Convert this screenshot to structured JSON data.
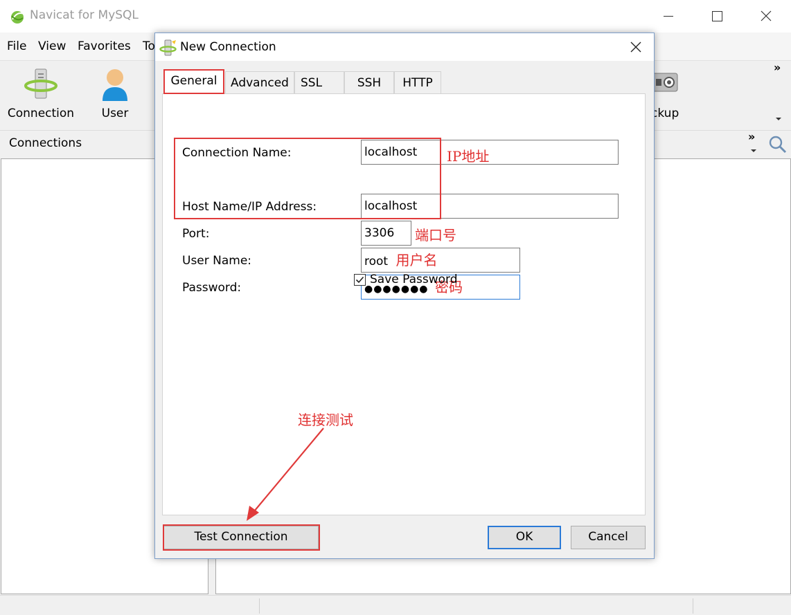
{
  "app": {
    "title": "Navicat for MySQL",
    "menu": [
      "File",
      "View",
      "Favorites",
      "To"
    ],
    "toolbar": [
      {
        "label": "Connection",
        "icon": "connection-icon"
      },
      {
        "label": "User",
        "icon": "user-icon"
      },
      {
        "label": "ckup",
        "icon": "backup-icon"
      }
    ],
    "connections_header": "Connections",
    "more_glyph": "»"
  },
  "dialog": {
    "title": "New Connection",
    "tabs": [
      "General",
      "Advanced",
      "SSL",
      "SSH",
      "HTTP"
    ],
    "active_tab": "General",
    "fields": {
      "connection_name": {
        "label": "Connection Name:",
        "value": "localhost"
      },
      "host": {
        "label": "Host Name/IP Address:",
        "value": "localhost"
      },
      "port": {
        "label": "Port:",
        "value": "3306"
      },
      "user": {
        "label": "User Name:",
        "value": "root"
      },
      "password": {
        "label": "Password:",
        "value": "●●●●●●●"
      }
    },
    "save_password": {
      "label": "Save Password",
      "checked": true
    },
    "buttons": {
      "test": "Test Connection",
      "ok": "OK",
      "cancel": "Cancel"
    }
  },
  "annotations": {
    "ip": "IP地址",
    "port": "端口号",
    "user": "用户名",
    "password": "密码",
    "test": "连接测试",
    "color": "#e03a3a"
  }
}
